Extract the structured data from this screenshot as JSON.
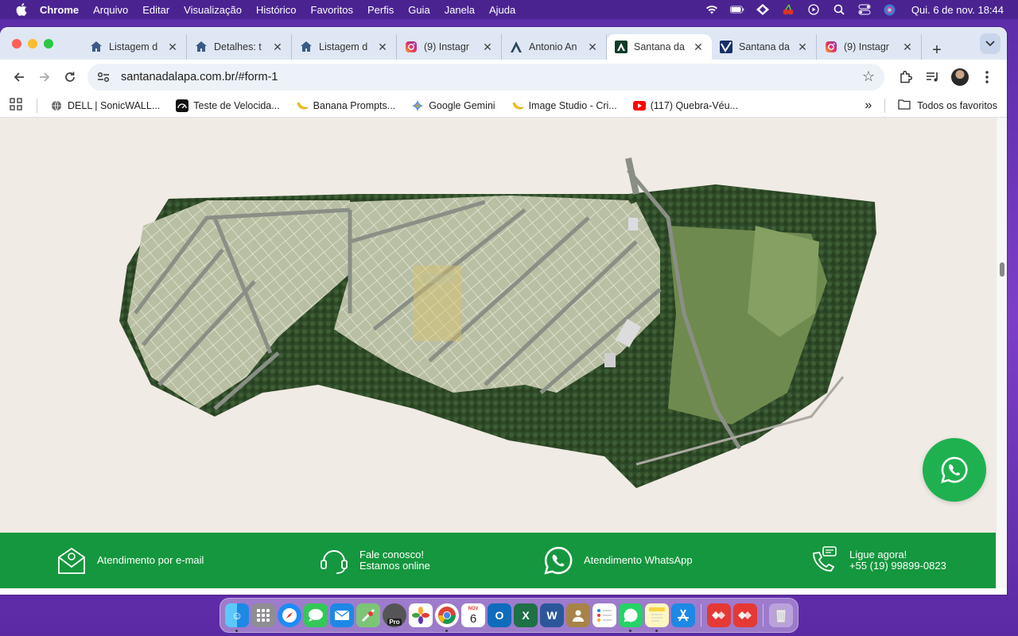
{
  "menubar": {
    "app_name": "Chrome",
    "items": [
      "Arquivo",
      "Editar",
      "Visualização",
      "Histórico",
      "Favoritos",
      "Perfis",
      "Guia",
      "Janela",
      "Ajuda"
    ],
    "clock": "Qui. 6 de nov.  18:44"
  },
  "tabs": [
    {
      "title": "Listagem d",
      "icon": "house-icon",
      "active": false
    },
    {
      "title": "Detalhes: t",
      "icon": "house-icon",
      "active": false
    },
    {
      "title": "Listagem d",
      "icon": "house-icon",
      "active": false
    },
    {
      "title": "(9) Instagr",
      "icon": "instagram-icon",
      "active": false
    },
    {
      "title": "Antonio An",
      "icon": "antonio-logo-icon",
      "active": false
    },
    {
      "title": "Santana da",
      "icon": "santana-logo-icon",
      "active": true
    },
    {
      "title": "Santana da",
      "icon": "santana-blue-logo-icon",
      "active": false
    },
    {
      "title": "(9) Instagr",
      "icon": "instagram-icon",
      "active": false
    }
  ],
  "toolbar": {
    "url": "santanadalapa.com.br/#form-1"
  },
  "bookmarks": [
    {
      "label": "DELL | SonicWALL...",
      "icon": "globe-icon"
    },
    {
      "label": "Teste de Velocida...",
      "icon": "speedtest-icon"
    },
    {
      "label": "Banana Prompts...",
      "icon": "banana-icon"
    },
    {
      "label": "Google Gemini",
      "icon": "gemini-icon"
    },
    {
      "label": "Image Studio - Cri...",
      "icon": "banana-icon"
    },
    {
      "label": "(117) Quebra-Véu...",
      "icon": "youtube-icon"
    }
  ],
  "bookmarks_folder": "Todos os favoritos",
  "contacts": [
    {
      "lines": [
        "Atendimento por e-mail"
      ],
      "icon": "email-icon"
    },
    {
      "lines": [
        "Fale conosco!",
        "Estamos online"
      ],
      "icon": "headset-icon"
    },
    {
      "lines": [
        "Atendimento WhatsApp"
      ],
      "icon": "whatsapp-icon"
    },
    {
      "lines": [
        "Ligue agora!",
        "+55 (19) 99899-0823"
      ],
      "icon": "phone-icon"
    }
  ],
  "dock": {
    "calendar_day": "6",
    "calendar_month": "NOV"
  },
  "colors": {
    "footer_green": "#14973e",
    "whatsapp_green": "#1fb150",
    "page_bg": "#f0ebe4"
  }
}
